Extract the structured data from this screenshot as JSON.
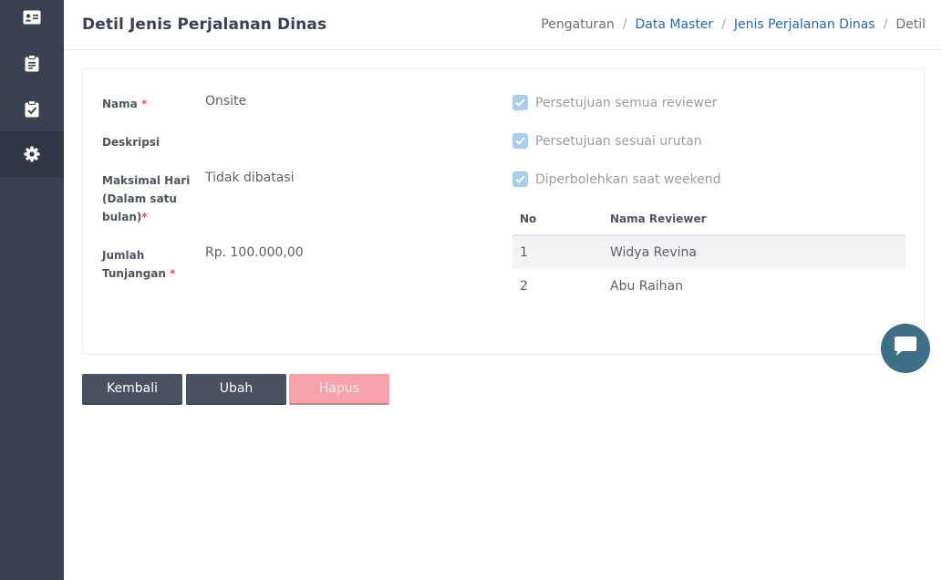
{
  "sidebar": {
    "items": [
      {
        "icon": "id-card-icon",
        "active": false
      },
      {
        "icon": "clipboard-icon",
        "active": false
      },
      {
        "icon": "clipboard-check-icon",
        "active": false
      },
      {
        "icon": "gear-icon",
        "active": true
      }
    ]
  },
  "header": {
    "title": "Detil Jenis Perjalanan Dinas",
    "breadcrumb": [
      "Pengaturan",
      "Data Master",
      "Jenis Perjalanan Dinas",
      "Detil"
    ],
    "separator": "/"
  },
  "form": {
    "required_mark": "*",
    "nama": {
      "label": "Nama",
      "value": "Onsite"
    },
    "deskripsi": {
      "label": "Deskripsi",
      "value": ""
    },
    "maksimal_hari": {
      "label_lines": [
        "Maksimal Hari",
        "(Dalam satu",
        "bulan)"
      ],
      "value": "Tidak dibatasi"
    },
    "jumlah_tunjangan": {
      "label_lines": [
        "Jumlah",
        "Tunjangan"
      ],
      "value": "Rp. 100.000,00"
    }
  },
  "checks": [
    {
      "label": "Persetujuan semua reviewer",
      "checked": true
    },
    {
      "label": "Persetujuan sesuai urutan",
      "checked": true
    },
    {
      "label": "Diperbolehkan saat weekend",
      "checked": true
    }
  ],
  "reviewers": {
    "columns": [
      "No",
      "Nama Reviewer"
    ],
    "rows": [
      {
        "no": "1",
        "name": "Widya Revina"
      },
      {
        "no": "2",
        "name": "Abu Raihan"
      }
    ]
  },
  "buttons": {
    "back": "Kembali",
    "edit": "Ubah",
    "delete": "Hapus"
  },
  "colors": {
    "sidebar": "#3a4252",
    "link": "#2d6aa8",
    "required": "#e25555",
    "checkbox": "#a9cdea",
    "button_dark": "#4a5160",
    "button_danger": "#f7a3ab",
    "chat_fab": "#3f6e87"
  }
}
